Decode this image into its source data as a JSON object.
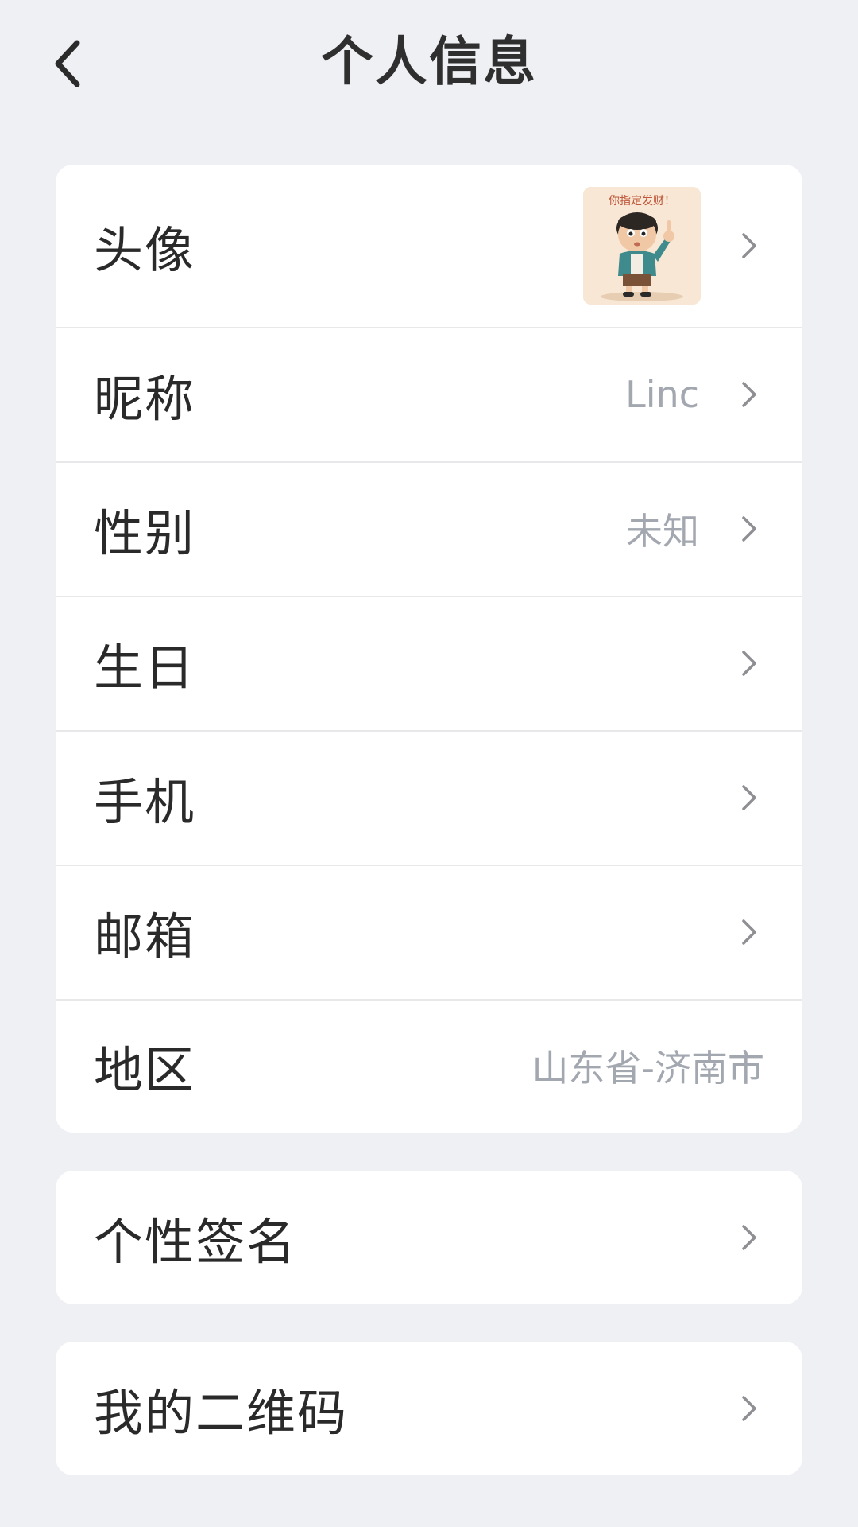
{
  "header": {
    "title": "个人信息"
  },
  "profile": {
    "rows": [
      {
        "label": "头像"
      },
      {
        "label": "昵称",
        "value": "Linc"
      },
      {
        "label": "性别",
        "value": "未知"
      },
      {
        "label": "生日"
      },
      {
        "label": "手机"
      },
      {
        "label": "邮箱"
      },
      {
        "label": "地区",
        "value": "山东省-济南市"
      }
    ]
  },
  "signature": {
    "label": "个性签名"
  },
  "qrcode": {
    "label": "我的二维码"
  },
  "avatar_image": {
    "caption": "你指定发财！"
  },
  "colors": {
    "background": "#eff0f4",
    "card": "#ffffff",
    "label_text": "#2a2a2a",
    "value_text": "#a3a8b0",
    "chevron": "#8e8e93"
  }
}
